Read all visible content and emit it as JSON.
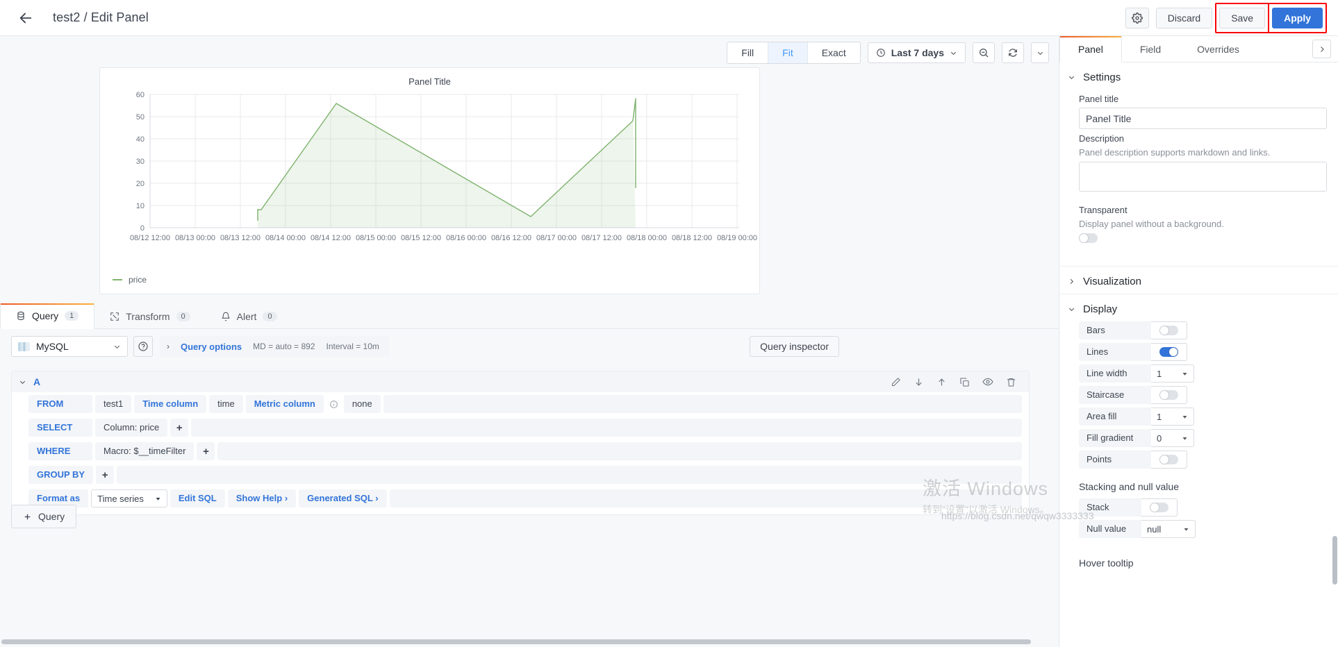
{
  "topnav": {
    "back_icon": "arrow-left-icon",
    "breadcrumb": "test2 / Edit Panel",
    "settings_icon": "gear-icon",
    "discard_label": "Discard",
    "save_label": "Save",
    "apply_label": "Apply",
    "accent_primary": "#3274d9",
    "annotation_color": "#fb0007"
  },
  "viz_toolbar": {
    "segments": [
      {
        "label": "Fill",
        "active": false
      },
      {
        "label": "Fit",
        "active": true
      },
      {
        "label": "Exact",
        "active": false
      }
    ],
    "time_range": "Last 7 days",
    "clock_icon": "clock-icon",
    "time_chevron": "chevron-down-icon",
    "zoom_out_icon": "zoom-out-icon",
    "refresh_icon": "refresh-icon",
    "refresh_chevron": "chevron-down-icon"
  },
  "panel_preview": {
    "title": "Panel Title",
    "legend": [
      {
        "label": "price",
        "color": "#7eb26d"
      }
    ]
  },
  "chart_data": {
    "type": "area",
    "title": "Panel Title",
    "xlabel": "",
    "ylabel": "",
    "ylim": [
      0,
      60
    ],
    "yticks": [
      0,
      10,
      20,
      30,
      40,
      50,
      60
    ],
    "xticks": [
      "08/12 12:00",
      "08/13 00:00",
      "08/13 12:00",
      "08/14 00:00",
      "08/14 12:00",
      "08/15 00:00",
      "08/15 12:00",
      "08/16 00:00",
      "08/16 12:00",
      "08/17 00:00",
      "08/17 12:00",
      "08/18 00:00",
      "08/18 12:00",
      "08/19 00:00"
    ],
    "grid": true,
    "legend_position": "bottom-left",
    "series": [
      {
        "name": "price",
        "color": "#7eb26d",
        "fill_color": "rgba(126,178,109,0.12)",
        "x": [
          "08/13 18:00",
          "08/13 19:00",
          "08/14 14:00",
          "08/16 16:00",
          "08/17 18:00",
          "08/17 19:00"
        ],
        "values": [
          3,
          8,
          56,
          5,
          48,
          56
        ]
      }
    ]
  },
  "query_tabs": [
    {
      "label": "Query",
      "count": "1",
      "icon": "database-icon",
      "active": true
    },
    {
      "label": "Transform",
      "count": "0",
      "icon": "transform-icon",
      "active": false
    },
    {
      "label": "Alert",
      "count": "0",
      "icon": "bell-icon",
      "active": false
    }
  ],
  "datasource": {
    "name": "MySQL",
    "logo_icon": "mysql-logo-icon",
    "chevron_icon": "chevron-down-icon",
    "help_icon": "help-circle-icon",
    "query_options_label": "Query options",
    "query_options_chevron": "chevron-right-icon",
    "max_data_points": "MD = auto = 892",
    "interval": "Interval = 10m",
    "query_inspector_label": "Query inspector"
  },
  "query": {
    "ref_id": "A",
    "collapse_icon": "chevron-down-icon",
    "actions": [
      {
        "name": "edit-query-icon",
        "title": "Edit"
      },
      {
        "name": "move-down-icon",
        "title": "Move down"
      },
      {
        "name": "move-up-icon",
        "title": "Move up"
      },
      {
        "name": "duplicate-query-icon",
        "title": "Duplicate"
      },
      {
        "name": "hide-query-icon",
        "title": "Toggle visibility"
      },
      {
        "name": "delete-query-icon",
        "title": "Delete"
      }
    ],
    "rows": {
      "from_label": "FROM",
      "from_table": "test1",
      "time_column_label": "Time column",
      "time_column_value": "time",
      "metric_column_label": "Metric column",
      "metric_column_info_icon": "info-circle-icon",
      "metric_column_value": "none",
      "select_label": "SELECT",
      "select_column": "Column: price",
      "select_plus": "+",
      "where_label": "WHERE",
      "where_macro": "Macro: $__timeFilter",
      "where_plus": "+",
      "group_by_label": "GROUP BY",
      "group_by_plus": "+",
      "format_as_label": "Format as",
      "format_as_value": "Time series",
      "format_chevron": "chevron-down-icon",
      "edit_sql_label": "Edit SQL",
      "show_help_label": "Show Help",
      "show_help_chevron": "chevron-right-icon",
      "generated_sql_label": "Generated SQL",
      "generated_sql_chevron": "chevron-right-icon"
    }
  },
  "add_query": {
    "label": "Query",
    "plus_icon": "plus-icon"
  },
  "options_pane": {
    "tabs": [
      {
        "label": "Panel",
        "active": true
      },
      {
        "label": "Field",
        "active": false
      },
      {
        "label": "Overrides",
        "active": false
      }
    ],
    "expand_icon": "chevron-right-icon",
    "settings": {
      "section_title": "Settings",
      "chevron": "chevron-down-icon",
      "panel_title_label": "Panel title",
      "panel_title_value": "Panel Title",
      "description_label": "Description",
      "description_hint": "Panel description supports markdown and links.",
      "description_value": "",
      "transparent_label": "Transparent",
      "transparent_hint": "Display panel without a background.",
      "transparent_on": false
    },
    "visualization": {
      "section_title": "Visualization",
      "chevron": "chevron-right-icon"
    },
    "display": {
      "section_title": "Display",
      "chevron": "chevron-down-icon",
      "items": [
        {
          "label": "Bars",
          "type": "toggle",
          "value": "off"
        },
        {
          "label": "Lines",
          "type": "toggle",
          "value": "on"
        },
        {
          "label": "Line width",
          "type": "select",
          "value": "1"
        },
        {
          "label": "Staircase",
          "type": "toggle",
          "value": "off"
        },
        {
          "label": "Area fill",
          "type": "select",
          "value": "1"
        },
        {
          "label": "Fill gradient",
          "type": "select",
          "value": "0"
        },
        {
          "label": "Points",
          "type": "toggle",
          "value": "off"
        }
      ],
      "stacking_title": "Stacking and null value",
      "stacking_items": [
        {
          "label": "Stack",
          "type": "toggle",
          "value": "off"
        },
        {
          "label": "Null value",
          "type": "select",
          "value": "null"
        }
      ],
      "hover_tooltip_title": "Hover tooltip"
    }
  },
  "watermark": {
    "line1": "激活 Windows",
    "line2": "转到\"设置\"以激活 Windows。",
    "url": "https://blog.csdn.net/qwqw3333333"
  }
}
